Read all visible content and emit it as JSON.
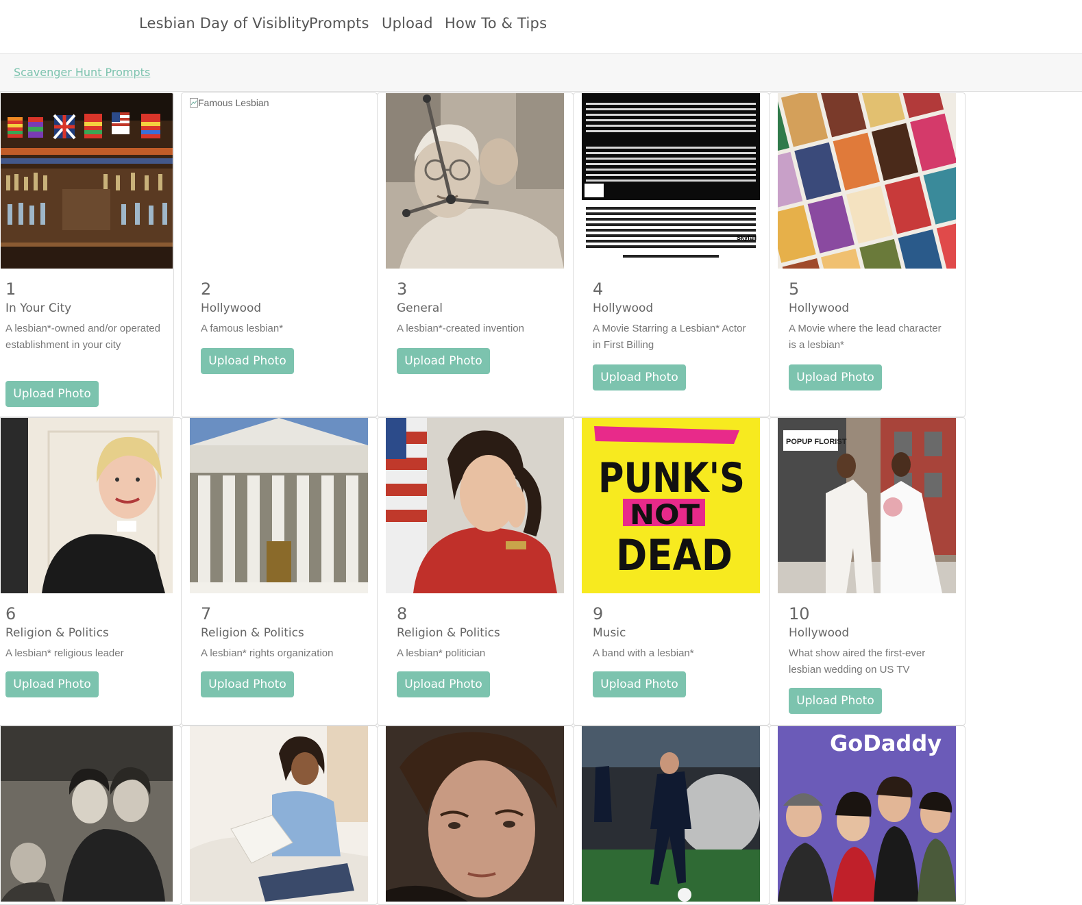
{
  "nav": {
    "items": [
      "Lesbian Day of Visiblity",
      "Prompts",
      "Upload",
      "How To & Tips"
    ]
  },
  "breadcrumb": {
    "link": "Scavenger Hunt Prompts"
  },
  "upload_label": "Upload Photo",
  "cards": [
    {
      "num": "1",
      "cat": "In Your City",
      "desc": "A lesbian*-owned and/or operated establishment in your city"
    },
    {
      "num": "2",
      "cat": "Hollywood",
      "desc": "A famous lesbian*",
      "alt": "Famous Lesbian"
    },
    {
      "num": "3",
      "cat": "General",
      "desc": "A lesbian*-created invention"
    },
    {
      "num": "4",
      "cat": "Hollywood",
      "desc": "A Movie Starring a Lesbian* Actor in First Billing"
    },
    {
      "num": "5",
      "cat": "Hollywood",
      "desc": "A Movie where the lead character is a lesbian*"
    },
    {
      "num": "6",
      "cat": "Religion & Politics",
      "desc": "A lesbian* religious leader"
    },
    {
      "num": "7",
      "cat": "Religion & Politics",
      "desc": "A lesbian* rights organization"
    },
    {
      "num": "8",
      "cat": "Religion & Politics",
      "desc": "A lesbian* politician"
    },
    {
      "num": "9",
      "cat": "Music",
      "desc": "A band with a lesbian*"
    },
    {
      "num": "10",
      "cat": "Hollywood",
      "desc": "What show aired the first-ever lesbian wedding on US TV"
    }
  ],
  "image_text": {
    "poster_wordmark": "Skyfall",
    "punk_line1": "PUNK'S",
    "punk_line2": "NOT",
    "punk_line3": "DEAD",
    "florist_sign": "POPUP FLORIST",
    "godaddy": "GoDaddy"
  }
}
